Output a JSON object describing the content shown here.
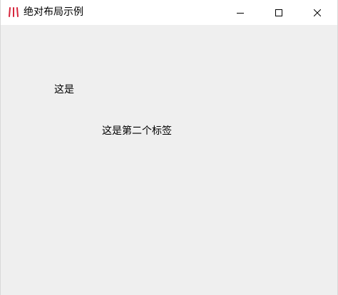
{
  "window": {
    "title": "绝对布局示例",
    "icon": "app-logo-icon",
    "accent_color": "#d7263d",
    "controls": {
      "minimize": "minimize-icon",
      "maximize": "maximize-icon",
      "close": "close-icon"
    }
  },
  "labels": {
    "first": "这是",
    "second": "这是第二个标签"
  },
  "colors": {
    "titlebar_bg": "#ffffff",
    "client_bg": "#efefef",
    "text": "#000000"
  }
}
